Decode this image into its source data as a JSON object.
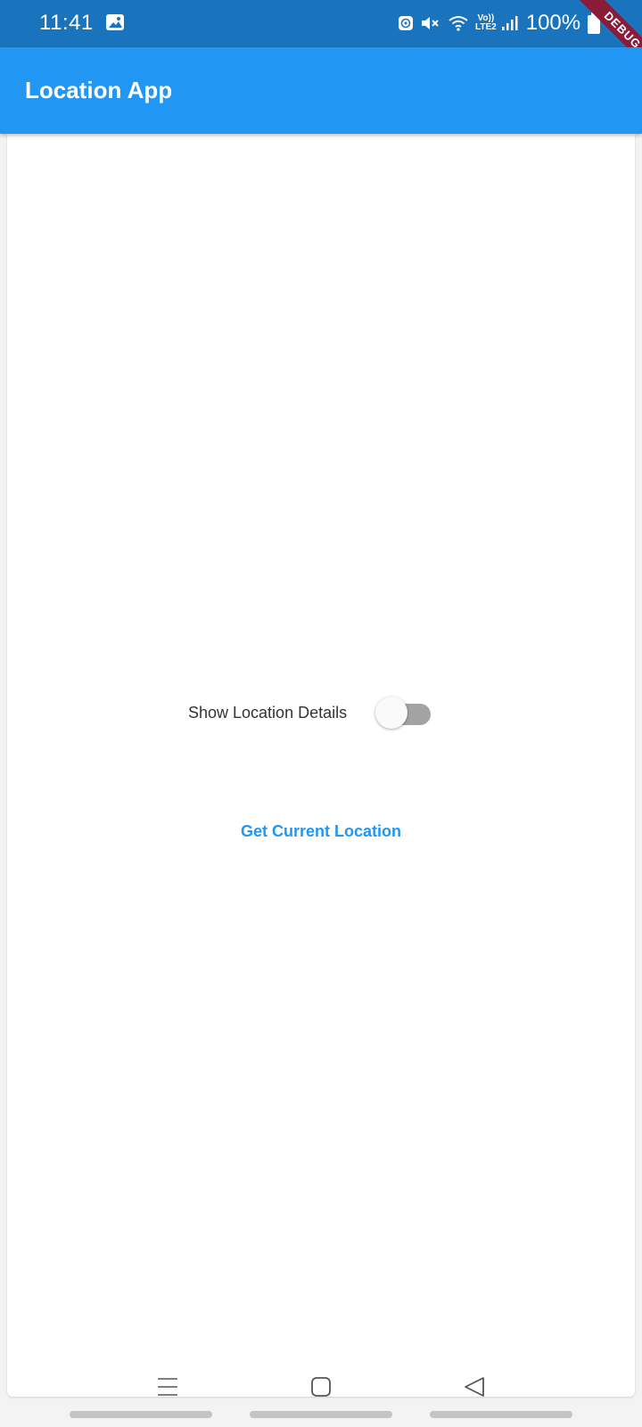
{
  "status_bar": {
    "time": "11:41",
    "volte": [
      "Vo))",
      "LTE2"
    ],
    "battery": "100%",
    "icons": [
      "gallery-icon",
      "whatsapp-icon",
      "mute-icon",
      "wifi-icon",
      "volte-icon",
      "signal-icon",
      "battery-icon"
    ]
  },
  "debug_banner": "DEBUG",
  "app_bar": {
    "title": "Location App"
  },
  "main": {
    "switch_label": "Show Location Details",
    "switch_on": false,
    "button_label": "Get Current Location"
  },
  "nav_bar": {
    "icons": [
      "recents-icon",
      "home-icon",
      "back-icon"
    ]
  },
  "colors": {
    "status_bar": "#1a73bd",
    "app_bar": "#2196f3",
    "accent": "#2196f3",
    "switch_track_off": "#a3a3a3",
    "debug_ribbon": "#8a1c3a"
  }
}
